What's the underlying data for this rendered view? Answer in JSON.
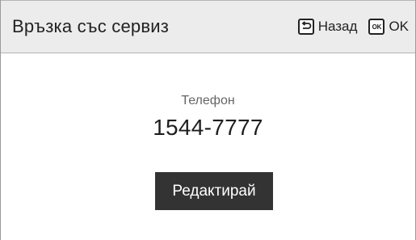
{
  "header": {
    "title": "Връзка със сервиз",
    "back": {
      "icon": "back-return-icon",
      "label": "Назад"
    },
    "ok": {
      "icon": "ok-key-icon",
      "icon_text": "OK",
      "label": "OK"
    }
  },
  "contact": {
    "phone_label": "Телефон",
    "phone_number": "1544-7777"
  },
  "actions": {
    "edit_label": "Редактирай"
  },
  "colors": {
    "header_bg": "#ececec",
    "button_bg": "#333333",
    "text_primary": "#222222",
    "text_secondary": "#666666"
  }
}
